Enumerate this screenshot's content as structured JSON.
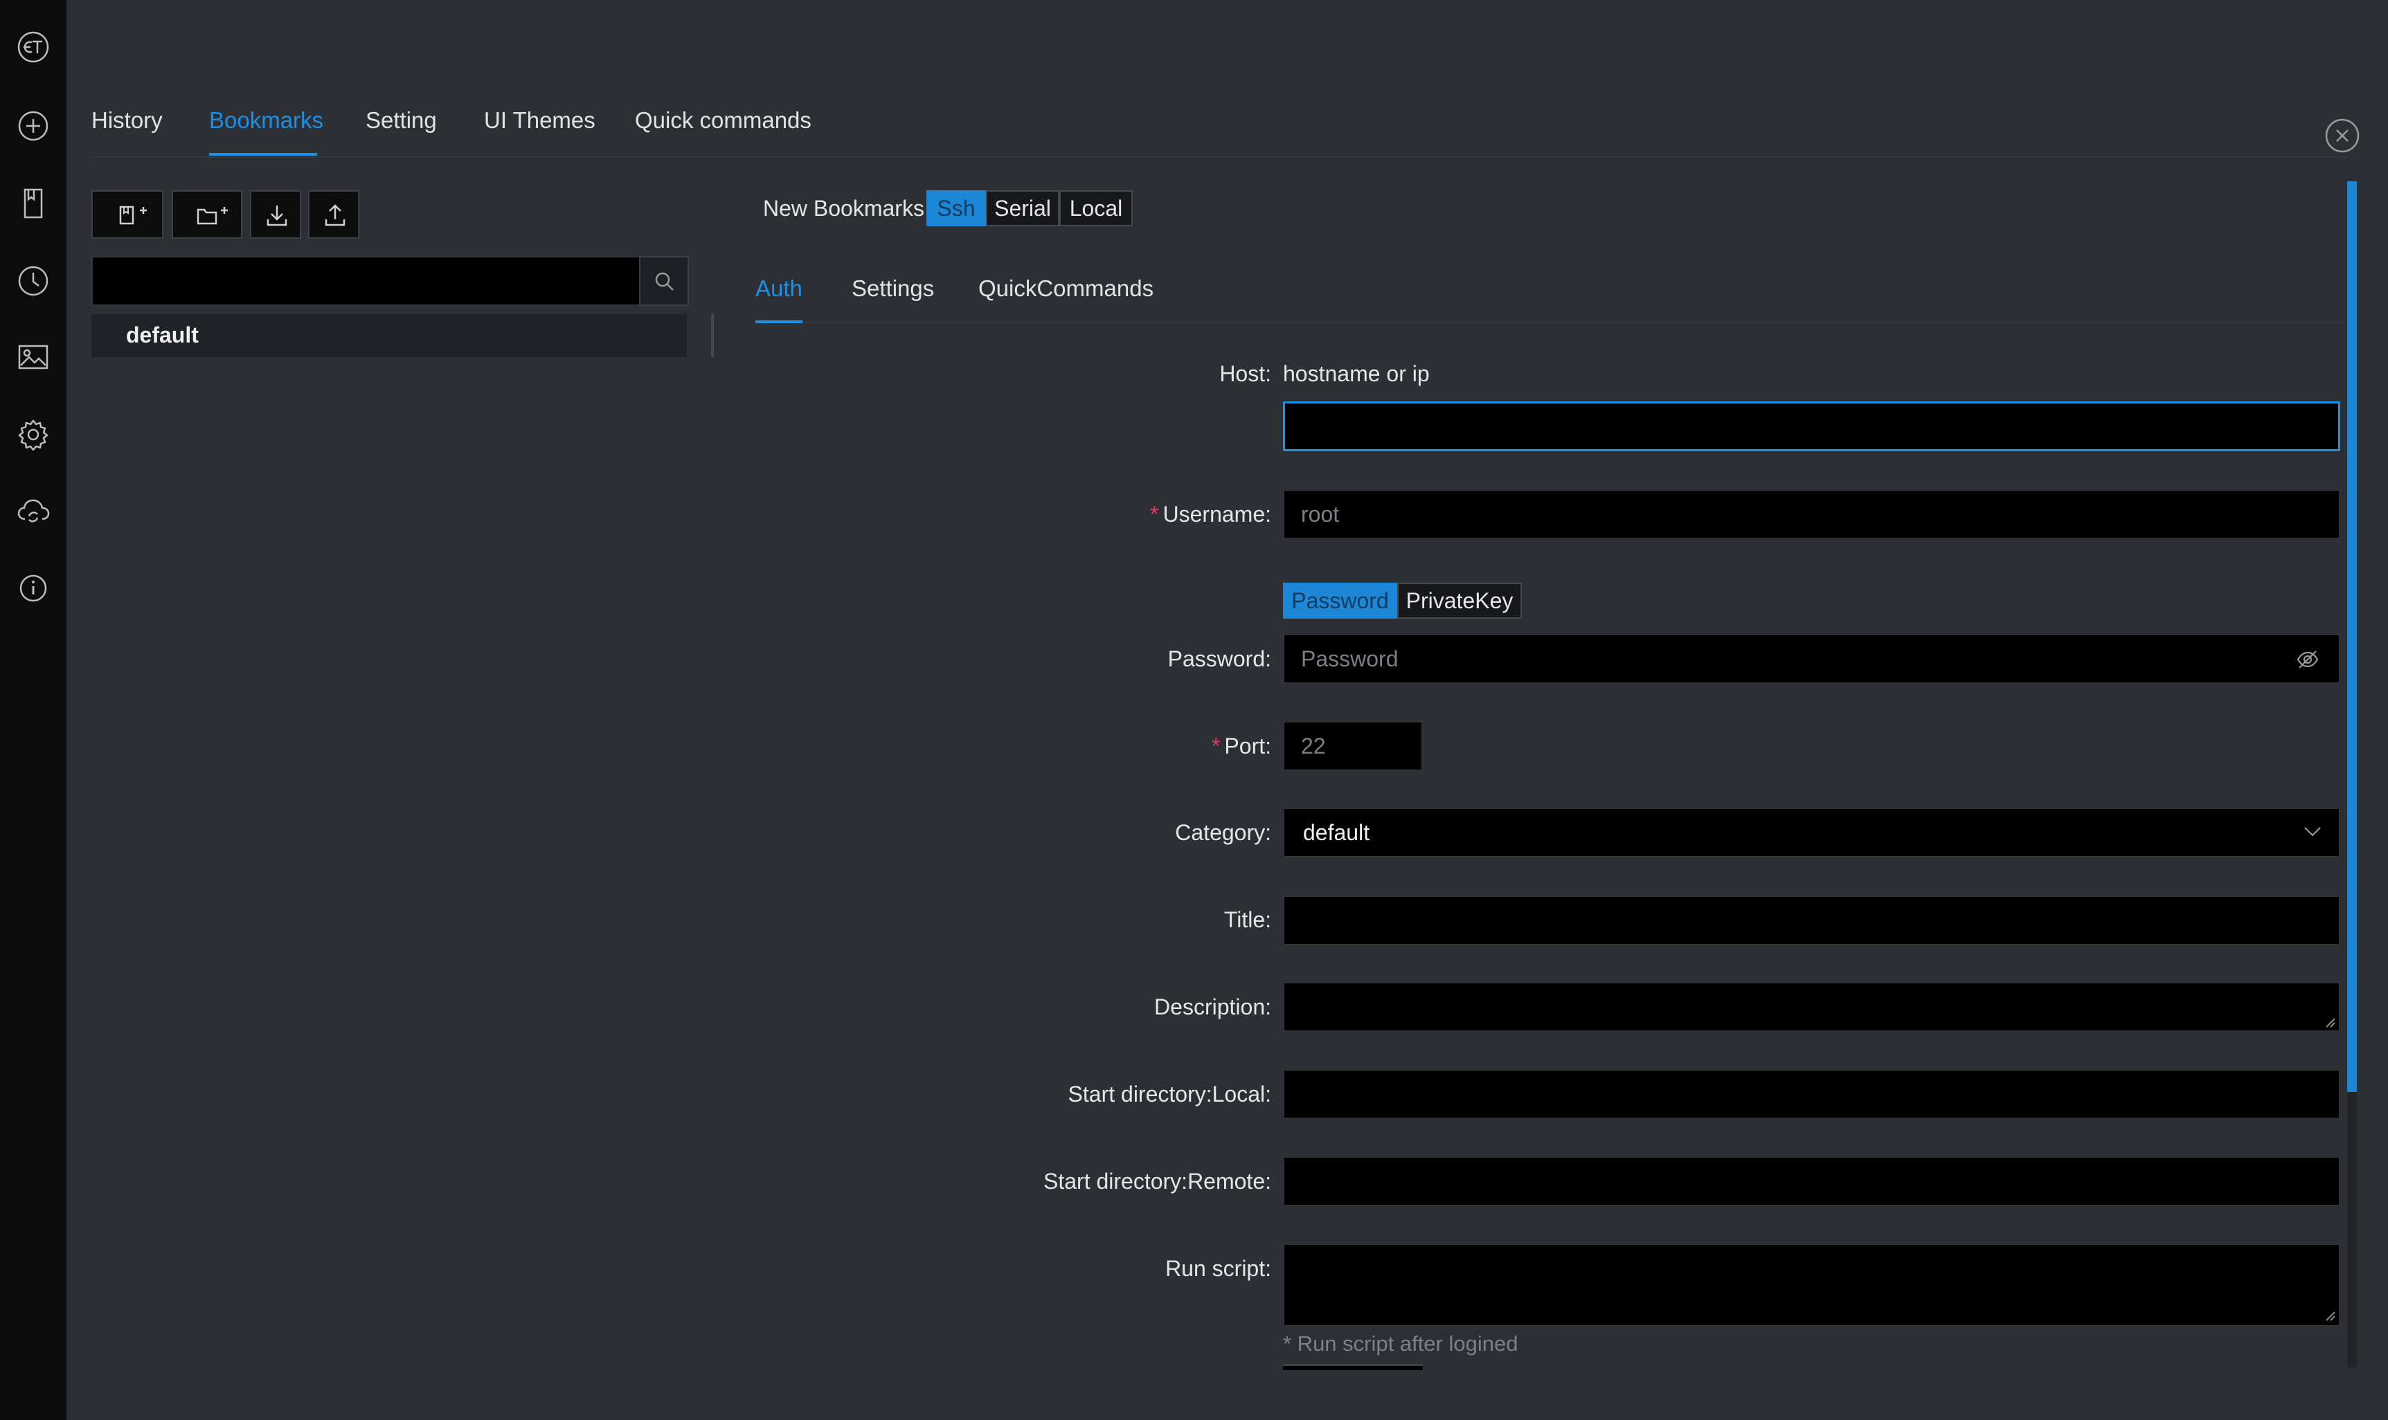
{
  "top_tabs": [
    "History",
    "Bookmarks",
    "Setting",
    "UI Themes",
    "Quick commands"
  ],
  "active_top_tab": "Bookmarks",
  "search": {
    "value": "",
    "placeholder": ""
  },
  "tree": {
    "items": [
      "default"
    ]
  },
  "new_bookmark": {
    "label": "New Bookmarks",
    "types": [
      "Ssh",
      "Serial",
      "Local"
    ],
    "active_type": "Ssh"
  },
  "sub_tabs": [
    "Auth",
    "Settings",
    "QuickCommands"
  ],
  "active_sub_tab": "Auth",
  "form": {
    "host": {
      "label": "Host",
      "hint": "hostname or ip",
      "value": ""
    },
    "username": {
      "label": "Username",
      "placeholder": "root",
      "required": true
    },
    "auth_types": [
      "Password",
      "PrivateKey"
    ],
    "active_auth_type": "Password",
    "password": {
      "label": "Password",
      "placeholder": "Password"
    },
    "port": {
      "label": "Port",
      "placeholder": "22",
      "required": true
    },
    "category": {
      "label": "Category",
      "value": "default"
    },
    "title": {
      "label": "Title",
      "value": ""
    },
    "description": {
      "label": "Description",
      "value": ""
    },
    "start_local": {
      "label": "Start directory:Local",
      "value": ""
    },
    "start_remote": {
      "label": "Start directory:Remote",
      "value": ""
    },
    "run_script": {
      "label": "Run script",
      "value": "",
      "help": "* Run script after logined"
    }
  },
  "colors": {
    "accent": "#1d8fe6",
    "rail": "#0c0c0c",
    "background": "#2c3035",
    "required": "#e0385d"
  },
  "icons": {
    "rail": [
      "logo-icon",
      "add-circle-icon",
      "bookmark-icon",
      "clock-icon",
      "picture-icon",
      "gear-icon",
      "cloud-sync-icon",
      "info-icon"
    ],
    "toolbar": [
      "new-bookmark-icon",
      "new-folder-icon",
      "import-icon",
      "export-icon"
    ]
  }
}
